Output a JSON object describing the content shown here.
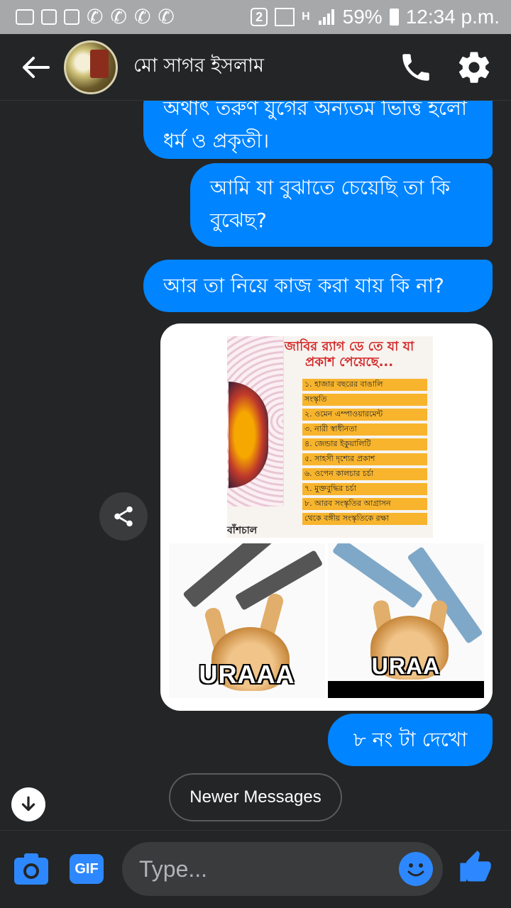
{
  "status_bar": {
    "sim_badge": "2",
    "network_type": "H",
    "battery": "59%",
    "time": "12:34 p.m."
  },
  "header": {
    "contact_name": "মো সাগর ইসলাম",
    "icons": [
      "back-arrow-icon",
      "phone-icon",
      "settings-gear-icon"
    ]
  },
  "messages": [
    {
      "id": "m1",
      "text": "অর্থাৎ তরুণ যুগের অন্যতম ভিত্তি হলো ধর্ম ও প্রকৃতী।"
    },
    {
      "id": "m2",
      "text": "আমি যা বুঝাতে চেয়েছি তা কি বুঝেছ?"
    },
    {
      "id": "m3",
      "text": "আর তা নিয়ে কাজ করা যায় কি না?"
    },
    {
      "id": "m4",
      "text": "৮ নং টা দেখো"
    }
  ],
  "image_message": {
    "poster_title": "জাবির র‍্যাগ ডে তে যা যা প্রকাশ পেয়েছে...",
    "poster_items": [
      "১. হাজার বছরের বাঙালি",
      "সংস্কৃতি",
      "২. ওমেন এম্পাওয়ারমেন্ট",
      "৩. নারী স্বাধীনতা",
      "৪. জেন্ডার ইকুয়ালিটি",
      "৫. সাহসী দৃশ্যের প্রকাশ",
      "৬. ওপেন কালচার চর্চা",
      "৭. মুক্তবুদ্ধির চর্চা",
      "৮. আরব সংস্কৃতির আগ্রাসন",
      "থেকে বঙ্গীয় সংস্কৃতিকে রক্ষা"
    ],
    "poster_logo": "বাঁশচাল",
    "meme_left_caption": "URAAA",
    "meme_right_caption": "URAA"
  },
  "newer_messages_label": "Newer Messages",
  "composer": {
    "placeholder": "Type...",
    "gif_label": "GIF"
  },
  "colors": {
    "bubble": "#0084ff",
    "background": "#242526",
    "accent": "#2d88ff"
  }
}
